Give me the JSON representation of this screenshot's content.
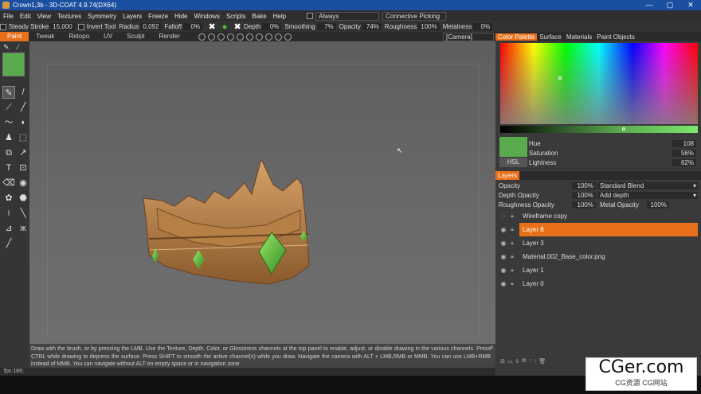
{
  "window": {
    "title": "Crown1,3b - 3D-COAT 4.9.74(DX64)",
    "controls": [
      "—",
      "▢",
      "✕"
    ]
  },
  "menu": [
    "File",
    "Edit",
    "View",
    "Textures",
    "Symmetry",
    "Layers",
    "Freeze",
    "Hide",
    "Windows",
    "Scripts",
    "Bake",
    "Help"
  ],
  "menu_dropdowns": {
    "always": "Always",
    "picking": "Connective  Picking"
  },
  "toolbar": {
    "steady_stroke": "Steady  Stroke",
    "steady_value": "15,000",
    "invert_tool": "Invert  Tool",
    "radius": "Radius",
    "radius_value": "0,092",
    "falloff": "Falloff",
    "falloff_value": "0%",
    "depth": "Depth",
    "depth_value": "0%",
    "smoothing": "Smoothing",
    "smoothing_value": "7%",
    "opacity": "Opacity",
    "opacity_value": "74%",
    "roughness": "Roughness",
    "roughness_value": "100%",
    "metalness": "Metalness",
    "metalness_value": "0%"
  },
  "tabs": [
    "Paint",
    "Tweak",
    "Retopo",
    "UV",
    "Sculpt",
    "Render"
  ],
  "camera": "[Camera]",
  "hint_text": "Draw with the brush, or by pressing the LMB. Use the Texture, Depth, Color, or Glossiness channels at the top panel to enable, adjust, or disable drawing in the various channels. Press CTRL while drawing to depress the surface. Press SHIFT to smooth the active channel(s) while you draw. Navigate the camera with ALT + LMB,RMB or MMB. You can use LMB+RMB instead of MMB. You can navigate without ALT on empty space or in navigation zone",
  "status": "fps:186;",
  "right_tabs": [
    "Color  Palette",
    "Surface",
    "Materials",
    "Paint  Objects"
  ],
  "color": {
    "current": "#5aaa4e",
    "mode": "HSL",
    "hue_label": "Hue",
    "hue": "108",
    "saturation_label": "Saturation",
    "saturation": "56%",
    "lightness_label": "Lightness",
    "lightness": "62%"
  },
  "layers_panel": {
    "title": "Layers",
    "opacity_label": "Opacity",
    "opacity_value": "100%",
    "blend": "Standard  Blend",
    "depth_opacity_label": "Depth  Opacity",
    "depth_opacity_value": "100%",
    "depth_mode": "Add  depth",
    "roughness_opacity_label": "Roughness  Opacity",
    "roughness_opacity_value": "100%",
    "metal_opacity_label": "Metal  Opacity",
    "metal_opacity_value": "100%",
    "layers": [
      {
        "name": "Wireframe  copy",
        "active": false
      },
      {
        "name": "Layer  8",
        "active": true
      },
      {
        "name": "Layer  3",
        "active": false
      },
      {
        "name": "Material.002_Base_color.png",
        "active": false
      },
      {
        "name": "Layer  1",
        "active": false
      },
      {
        "name": "Layer  0",
        "active": false
      }
    ]
  },
  "watermark": {
    "big": "CGer.com",
    "small": "CG资源 CG网站"
  },
  "accent": "#e8701a",
  "crown_gold": "#b8864a",
  "gem_green": "#4fbf3a"
}
